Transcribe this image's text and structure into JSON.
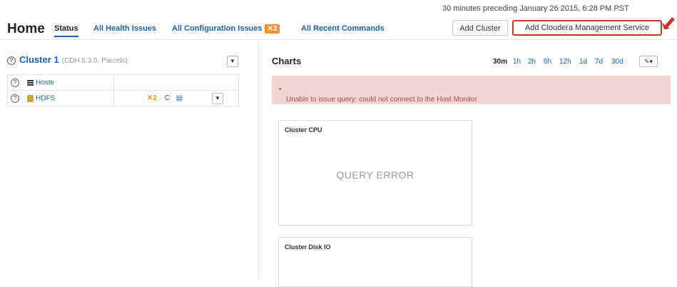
{
  "header": {
    "timestamp": "30 minutes preceding January 26 2015, 6:28 PM PST",
    "title": "Home",
    "tabs": [
      {
        "label": "Status"
      },
      {
        "label": "All Health Issues"
      },
      {
        "label": "All Configuration Issues",
        "badge": "✕2"
      },
      {
        "label": "All Recent Commands"
      }
    ],
    "buttons": {
      "add_cluster": "Add Cluster",
      "add_cms": "Add Cloudera Management Service"
    }
  },
  "cluster": {
    "name": "Cluster 1",
    "details": "(CDH 5.3.0, Parcels)",
    "services": [
      {
        "name": "Hosts",
        "icon": "hosts-icon"
      },
      {
        "name": "HDFS",
        "icon": "hdfs-icon",
        "issues": "✕2"
      }
    ]
  },
  "charts": {
    "title": "Charts",
    "ranges": [
      "30m",
      "1h",
      "2h",
      "6h",
      "12h",
      "1d",
      "7d",
      "30d"
    ],
    "selected_range": "30m",
    "error_message": "Unable to issue query: could not connect to the Host Monitor",
    "cards": [
      {
        "title": "Cluster CPU",
        "status": "QUERY ERROR"
      },
      {
        "title": "Cluster Disk IO",
        "status": ""
      }
    ]
  },
  "colors": {
    "link": "#1f5fa8",
    "badge": "#f0922a",
    "error_bg": "#f1d5d5",
    "error_text": "#b94a48",
    "highlight": "#c0392b"
  }
}
